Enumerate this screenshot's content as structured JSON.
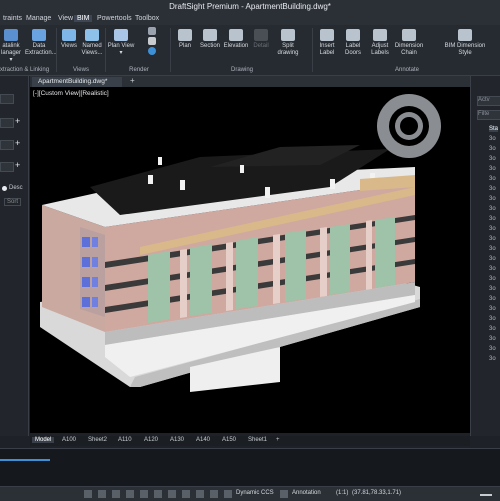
{
  "window": {
    "title": "DraftSight Premium - ApartmentBuilding.dwg*"
  },
  "menu": [
    {
      "label": "traints"
    },
    {
      "label": "Manage"
    },
    {
      "label": "View"
    },
    {
      "label": "BIM",
      "active": true
    },
    {
      "label": "Powertools"
    },
    {
      "label": "Toolbox"
    }
  ],
  "ribbon": {
    "buttons": [
      {
        "name": "datalink-manager-button",
        "label1": "atalink",
        "label2": "lanager ▾",
        "icon": "datalink-icon",
        "color": "#5a8fd0"
      },
      {
        "name": "data-extraction-button",
        "label1": "Data",
        "label2": "Extraction...",
        "icon": "data-extraction-icon",
        "color": "#6aa4e0"
      },
      {
        "name": "views-button",
        "label1": "Views",
        "label2": "",
        "icon": "views-icon",
        "color": "#7fb6e8"
      },
      {
        "name": "named-views-button",
        "label1": "Named",
        "label2": "Views...",
        "icon": "named-views-icon",
        "color": "#8ec1ea"
      },
      {
        "name": "plan-view-button",
        "label1": "Plan View",
        "label2": "▾",
        "icon": "plan-view-icon",
        "color": "#a9c6e6"
      },
      {
        "name": "plan-button",
        "label1": "Plan",
        "label2": "",
        "icon": "plan-icon",
        "color": "#b9c3cd"
      },
      {
        "name": "section-button",
        "label1": "Section",
        "label2": "",
        "icon": "section-icon",
        "color": "#b9c3cd"
      },
      {
        "name": "elevation-button",
        "label1": "Elevation",
        "label2": "",
        "icon": "elevation-icon",
        "color": "#b9c3cd"
      },
      {
        "name": "detail-button",
        "label1": "Detail",
        "label2": "",
        "icon": "detail-icon",
        "color": "#6b7078"
      },
      {
        "name": "split-drawing-button",
        "label1": "Split",
        "label2": "drawing",
        "icon": "split-drawing-icon",
        "color": "#b9c3cd"
      },
      {
        "name": "insert-label-button",
        "label1": "Insert",
        "label2": "Label",
        "icon": "insert-label-icon",
        "color": "#b9c3cd"
      },
      {
        "name": "label-doors-button",
        "label1": "Label",
        "label2": "Doors",
        "icon": "label-doors-icon",
        "color": "#b9c3cd"
      },
      {
        "name": "adjust-labels-button",
        "label1": "Adjust",
        "label2": "Labels",
        "icon": "adjust-labels-icon",
        "color": "#b9c3cd"
      },
      {
        "name": "dimension-chain-button",
        "label1": "Dimension",
        "label2": "Chain",
        "icon": "dimension-chain-icon",
        "color": "#b9c3cd"
      },
      {
        "name": "bim-dimension-style-button",
        "label1": "BIM Dimension",
        "label2": "Style",
        "icon": "bim-dimension-style-icon",
        "color": "#b9c3cd"
      }
    ],
    "groups": [
      {
        "label": "xtraction & Linking"
      },
      {
        "label": "Views"
      },
      {
        "label": "Render"
      },
      {
        "label": "Drawing"
      },
      {
        "label": "Annotate"
      }
    ]
  },
  "left_panel": {
    "sort_label": "Desc",
    "sort_button": "Sort"
  },
  "document": {
    "tab": "ApartmentBuilding.dwg*",
    "add_tab": "+"
  },
  "viewport": {
    "label": "[-][Custom View][Realistic]"
  },
  "right_panel": {
    "fields": [
      "Actv",
      "Filte"
    ],
    "rows": [
      "Sta",
      "3o",
      "3o",
      "3o",
      "3o",
      "3o",
      "3o",
      "3o",
      "3o",
      "3o",
      "3o",
      "3o",
      "3o",
      "3o",
      "3o",
      "3o",
      "3o",
      "3o",
      "3o",
      "3o",
      "3o",
      "3o",
      "3o",
      "3o"
    ]
  },
  "layout_tabs": [
    "Model",
    "A100",
    "Sheet2",
    "A110",
    "A120",
    "A130",
    "A140",
    "A150",
    "Sheet1",
    "+"
  ],
  "status_bar": {
    "ccs": "Dynamic CCS",
    "annotation": "Annotation",
    "scale": "(1:1)",
    "coords": "(37.81,78.33,1.71)"
  },
  "colors": {
    "accent": "#3d8fd6",
    "viewport_bg": "#000000",
    "panel_bg": "#22262c"
  }
}
